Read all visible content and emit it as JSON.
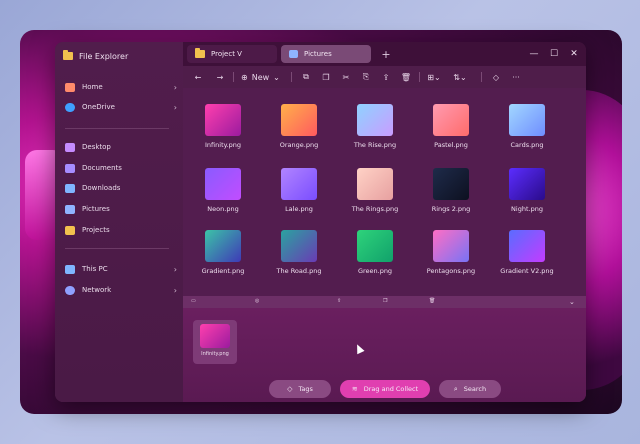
{
  "window": {
    "title": "File Explorer"
  },
  "tabs": [
    {
      "label": "Project V",
      "icon": "folder-icon"
    },
    {
      "label": "Pictures",
      "icon": "pictures-icon"
    }
  ],
  "window_controls": {
    "minimize": "—",
    "maximize": "☐",
    "close": "✕"
  },
  "toolbar": {
    "new_label": "New"
  },
  "sidebar": {
    "items": [
      {
        "label": "Home",
        "icon": "home-icon",
        "chevron": true
      },
      {
        "label": "OneDrive",
        "icon": "cloud-icon",
        "chevron": true
      },
      {
        "label": "Desktop",
        "icon": "desktop-icon"
      },
      {
        "label": "Documents",
        "icon": "documents-icon"
      },
      {
        "label": "Downloads",
        "icon": "downloads-icon"
      },
      {
        "label": "Pictures",
        "icon": "pictures-icon"
      },
      {
        "label": "Projects",
        "icon": "folder-icon"
      },
      {
        "label": "This PC",
        "icon": "pc-icon",
        "chevron": true
      },
      {
        "label": "Network",
        "icon": "network-icon",
        "chevron": true
      }
    ]
  },
  "files": [
    {
      "name": "Infinity.png",
      "color1": "#ff3fae",
      "color2": "#9b1b9f"
    },
    {
      "name": "Orange.png",
      "color1": "#ffb04a",
      "color2": "#ff5a5f"
    },
    {
      "name": "The Rise.png",
      "color1": "#8fd2ff",
      "color2": "#c99cff"
    },
    {
      "name": "Pastel.png",
      "color1": "#ff9bb0",
      "color2": "#ff6b6b"
    },
    {
      "name": "Cards.png",
      "color1": "#a2d7ff",
      "color2": "#6f8dff"
    },
    {
      "name": "Neon.png",
      "color1": "#8a5bff",
      "color2": "#c14dff"
    },
    {
      "name": "Lale.png",
      "color1": "#b184ff",
      "color2": "#7a4dff"
    },
    {
      "name": "The Rings.png",
      "color1": "#ffd2c6",
      "color2": "#e7a0a0"
    },
    {
      "name": "Rings 2.png",
      "color1": "#1e2b4a",
      "color2": "#0d1020"
    },
    {
      "name": "Night.png",
      "color1": "#5b2dff",
      "color2": "#2a0b8a"
    },
    {
      "name": "Gradient.png",
      "color1": "#3bc3a7",
      "color2": "#3f3ab7"
    },
    {
      "name": "The Road.png",
      "color1": "#2aa3a0",
      "color2": "#6a3bb5"
    },
    {
      "name": "Green.png",
      "color1": "#2ed37b",
      "color2": "#11a16b"
    },
    {
      "name": "Pentagons.png",
      "color1": "#ff6ec4",
      "color2": "#7873f5"
    },
    {
      "name": "Gradient V2.png",
      "color1": "#5a6cff",
      "color2": "#c33cff"
    }
  ],
  "tray": {
    "item": {
      "name": "Infinity.png"
    },
    "tags_label": "Tags",
    "drag_label": "Drag and Collect",
    "search_label": "Search"
  }
}
